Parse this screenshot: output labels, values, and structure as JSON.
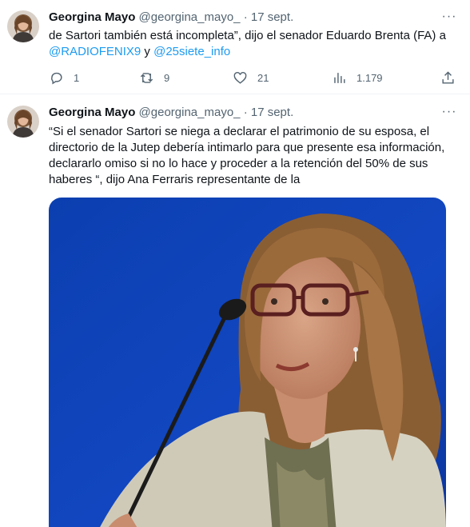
{
  "tweets": [
    {
      "author_name": "Georgina Mayo",
      "author_handle": "@georgina_mayo_",
      "separator": "·",
      "date": "17 sept.",
      "more_label": "···",
      "text_part1": "de Sartori también está incompleta”, dijo el senador Eduardo Brenta (FA) a",
      "mention1": "@RADIOFENIX9",
      "text_join": " y ",
      "mention2": "@25siete_info",
      "replies": "1",
      "retweets": "9",
      "likes": "21",
      "views": "1.179"
    },
    {
      "author_name": "Georgina Mayo",
      "author_handle": "@georgina_mayo_",
      "separator": "·",
      "date": "17 sept.",
      "more_label": "···",
      "text": "“Si el senador Sartori se niega a declarar el patrimonio de su esposa, el directorio de la Jutep debería intimarlo para que presente esa información, declararlo omiso si no lo hace y proceder a la retención del 50% de sus haberes “, dijo Ana Ferraris representante de la"
    }
  ],
  "icons": {
    "reply": "reply-icon",
    "retweet": "retweet-icon",
    "like": "heart-icon",
    "views": "views-icon",
    "share": "share-icon",
    "more": "more-icon"
  },
  "colors": {
    "accent": "#1d9bf0",
    "secondary_text": "#536471",
    "primary_text": "#0f1419",
    "divider": "#eff3f4"
  }
}
